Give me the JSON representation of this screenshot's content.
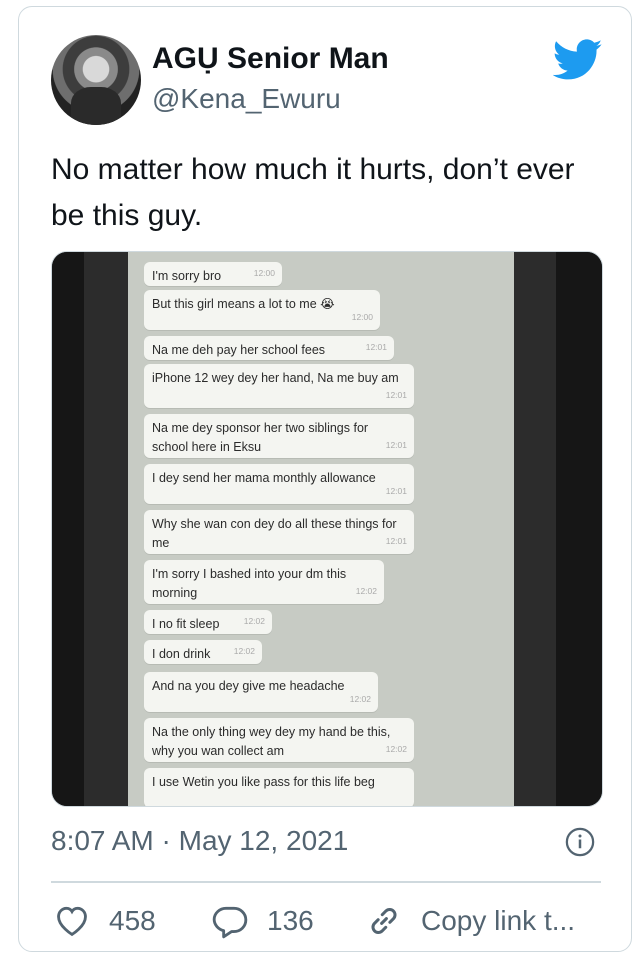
{
  "tweet": {
    "author_name": "AGỤ Senior Man",
    "author_handle": "@Kena_Ewuru",
    "text": "No matter how much it hurts, don’t ever be this guy.",
    "timestamp": "8:07 AM · May 12, 2021",
    "likes": "458",
    "replies": "136",
    "share_label": "Copy link t...",
    "brand_color": "#1d9bf0"
  },
  "chat": [
    {
      "msg": "I'm sorry bro",
      "time": "12:00"
    },
    {
      "msg": "But this girl means a lot to me 😭",
      "time": "12:00"
    },
    {
      "msg": "Na me deh pay her school fees",
      "time": "12:01"
    },
    {
      "msg": "iPhone 12 wey dey her hand, Na me buy am",
      "time": "12:01"
    },
    {
      "msg": "Na me dey sponsor her two siblings for school here in Eksu",
      "time": "12:01"
    },
    {
      "msg": "I dey send her mama monthly allowance",
      "time": "12:01"
    },
    {
      "msg": "Why she wan con dey do all these things for me",
      "time": "12:01"
    },
    {
      "msg": "I'm sorry I bashed into your dm this morning",
      "time": "12:02"
    },
    {
      "msg": "I no fit sleep",
      "time": "12:02"
    },
    {
      "msg": "I don drink",
      "time": "12:02"
    },
    {
      "msg": "And na you dey give me headache",
      "time": "12:02"
    },
    {
      "msg": "Na the only thing wey dey my hand be this, why you wan collect am",
      "time": "12:02"
    },
    {
      "msg": "I use Wetin you like pass for this life beg",
      "time": ""
    }
  ]
}
